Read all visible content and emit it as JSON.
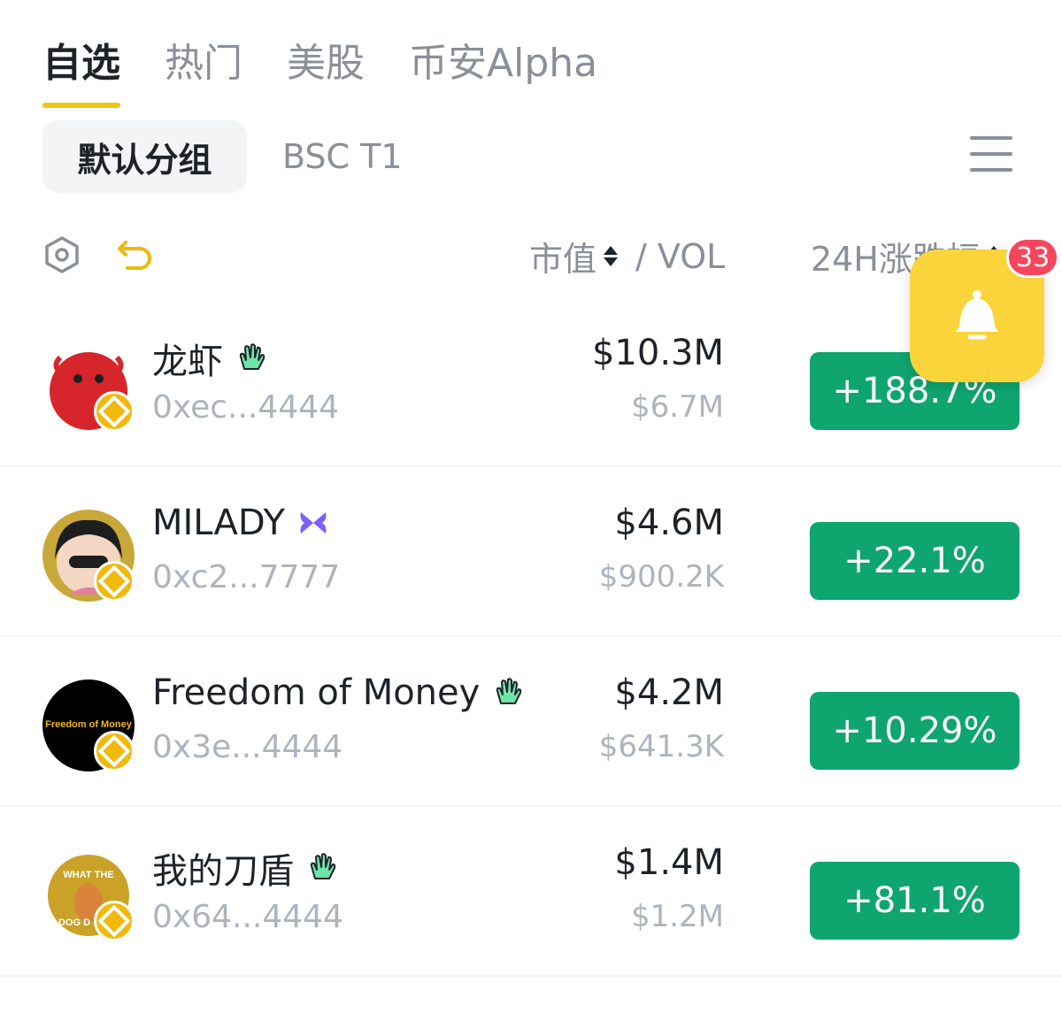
{
  "tabs": [
    {
      "label": "自选",
      "active": true
    },
    {
      "label": "热门",
      "active": false
    },
    {
      "label": "美股",
      "active": false
    },
    {
      "label": "币安Alpha",
      "active": false
    }
  ],
  "groups": {
    "selected": "默认分组",
    "other": "BSC T1"
  },
  "header": {
    "mcap_label": "市值",
    "vol_label": "/ VOL",
    "change_label": "24H涨跌幅"
  },
  "notification": {
    "count": "33"
  },
  "rows": [
    {
      "name": "龙虾",
      "address": "0xec...4444",
      "mcap": "$10.3M",
      "vol": "$6.7M",
      "change": "+188.7%",
      "tag_icon": "green-hand-icon",
      "avatar_color": "#d7262b"
    },
    {
      "name": "MILADY",
      "address": "0xc2...7777",
      "mcap": "$4.6M",
      "vol": "$900.2K",
      "change": "+22.1%",
      "tag_icon": "purple-butterfly-icon",
      "avatar_color": "#2b2b2b"
    },
    {
      "name": "Freedom of Money",
      "address": "0x3e...4444",
      "mcap": "$4.2M",
      "vol": "$641.3K",
      "change": "+10.29%",
      "tag_icon": "green-hand-icon",
      "avatar_color": "#000000",
      "avatar_text": "Freedom of Money"
    },
    {
      "name": "我的刀盾",
      "address": "0x64...4444",
      "mcap": "$1.4M",
      "vol": "$1.2M",
      "change": "+81.1%",
      "tag_icon": "green-hand-icon",
      "avatar_color": "#c9a227",
      "avatar_text": "WHAT THE DOG D"
    }
  ],
  "colors": {
    "accent": "#f0c512",
    "up_green": "#0ea56f",
    "badge_red": "#f6465d",
    "bell_yellow": "#f9d43a"
  }
}
